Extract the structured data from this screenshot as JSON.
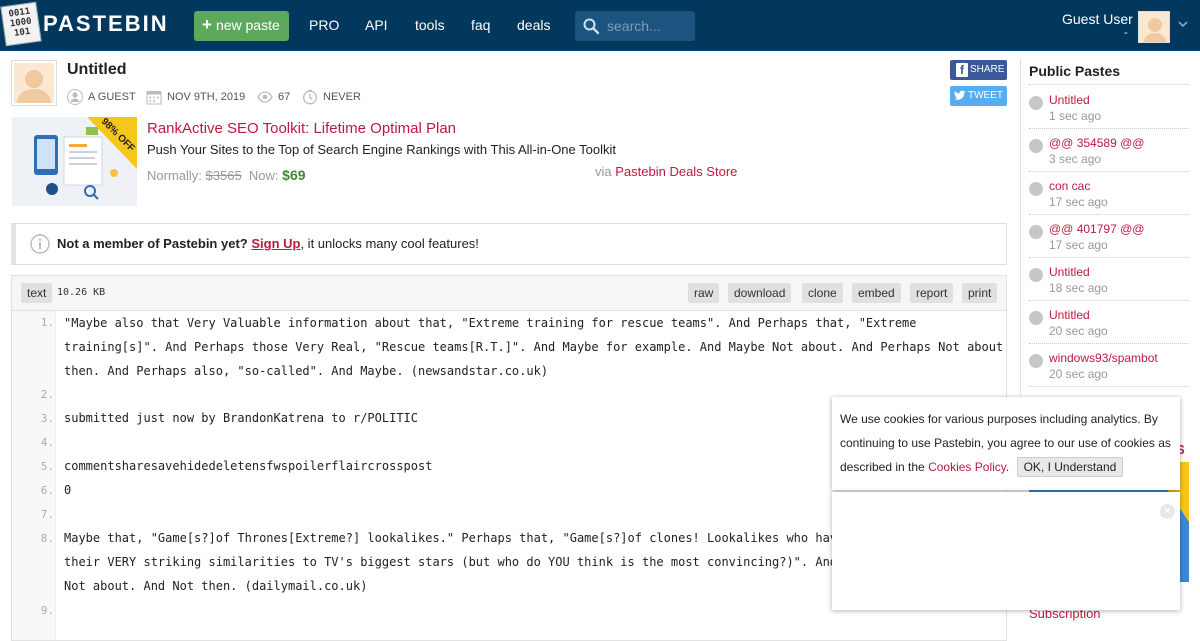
{
  "header": {
    "logo_bits": "0011\n1000\n101",
    "logo_text": "PASTEBIN",
    "new_paste": "new paste",
    "nav": [
      "PRO",
      "API",
      "tools",
      "faq",
      "deals"
    ],
    "search_placeholder": "search...",
    "user": "Guest User",
    "user_sub": "-"
  },
  "paste": {
    "title": "Untitled",
    "author": "A GUEST",
    "date": "NOV 9TH, 2019",
    "views": "67",
    "expires": "NEVER",
    "share": "SHARE",
    "tweet": "TWEET"
  },
  "ad": {
    "badge": "98% OFF",
    "title": "RankActive SEO Toolkit: Lifetime Optimal Plan",
    "desc": "Push Your Sites to the Top of Search Engine Rankings with This All-in-One Toolkit",
    "normally_label": "Normally:",
    "normally_price": "$3565",
    "now_label": "Now:",
    "now_price": "$69",
    "via_label": "via",
    "via_store": "Pastebin Deals Store"
  },
  "notice": {
    "bold": "Not a member of Pastebin yet?",
    "signup": "Sign Up",
    "rest": ", it unlocks many cool features!"
  },
  "code": {
    "syntax": "text",
    "size": "10.26 KB",
    "actions": [
      "raw",
      "download",
      "clone",
      "embed",
      "report",
      "print"
    ],
    "lines": [
      {
        "n": "1.",
        "text": "\"Maybe also that Very Valuable information about that, \"Extreme training for rescue teams\". And Perhaps that, \"Extreme training[s]\". And Perhaps those Very Real, \"Rescue teams[R.T.]\". And Maybe for example. And Maybe Not about. And Perhaps Not about then. And Perhaps also, \"so-called\". And Maybe. (newsandstar.co.uk)"
      },
      {
        "n": "2.",
        "text": ""
      },
      {
        "n": "3.",
        "text": "submitted just now by BrandonKatrena to r/POLITIC"
      },
      {
        "n": "4.",
        "text": ""
      },
      {
        "n": "5.",
        "text": "commentsharesavehidedeletensfwspoilerflaircrosspost"
      },
      {
        "n": "6.",
        "text": "0"
      },
      {
        "n": "7.",
        "text": ""
      },
      {
        "n": "8.",
        "text": "Maybe that, \"Game[s?]of Thrones[Extreme?] lookalikes.\" Perhaps that, \"Game[s?]of clones! Lookalikes who have c\ntheir VERY striking similarities to TV's biggest stars (but who do YOU think is the most convincing?)\". And Ma\nNot about. And Not then. (dailymail.co.uk)"
      },
      {
        "n": "9.",
        "text": ""
      }
    ]
  },
  "sidebar": {
    "title": "Public Pastes",
    "items": [
      {
        "name": "Untitled",
        "time": "1 sec ago"
      },
      {
        "name": "@@ 354589 @@",
        "time": "3 sec ago"
      },
      {
        "name": "con cac",
        "time": "17 sec ago"
      },
      {
        "name": "@@ 401797 @@",
        "time": "17 sec ago"
      },
      {
        "name": "Untitled",
        "time": "18 sec ago"
      },
      {
        "name": "Untitled",
        "time": "20 sec ago"
      },
      {
        "name": "windows93/spambot",
        "time": "20 sec ago"
      }
    ],
    "red_partial": "S",
    "subscription": "Subscription"
  },
  "cookie": {
    "text": "We use cookies for various purposes including analytics. By continuing to use Pastebin, you agree to our use of cookies as described in the",
    "link": "Cookies Policy",
    "dot": ".",
    "ok": "OK, I Understand",
    "close": "×"
  },
  "colors": {
    "header_bg": "#02375e",
    "accent_red": "#c0193f",
    "green_button": "#5ea85e"
  }
}
